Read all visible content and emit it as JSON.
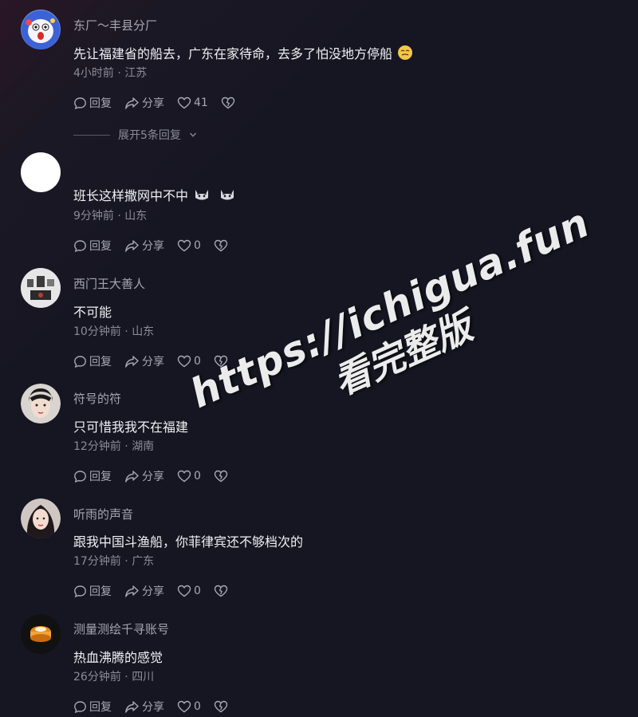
{
  "comments": [
    {
      "username": "东厂～丰县分厂",
      "text": "先让福建省的船去，广东在家待命，去多了怕没地方停船",
      "time": "4小时前",
      "location": "江苏",
      "reply_label": "回复",
      "share_label": "分享",
      "likes": "41",
      "emoji": "smug-face"
    },
    {
      "username": "",
      "text": "班长这样撒网中不中",
      "time": "9分钟前",
      "location": "山东",
      "reply_label": "回复",
      "share_label": "分享",
      "likes": "0",
      "emoji": "cat-face"
    },
    {
      "username": "西门王大善人",
      "text": "不可能",
      "time": "10分钟前",
      "location": "山东",
      "reply_label": "回复",
      "share_label": "分享",
      "likes": "0"
    },
    {
      "username": "符号的符",
      "text": "只可惜我我不在福建",
      "time": "12分钟前",
      "location": "湖南",
      "reply_label": "回复",
      "share_label": "分享",
      "likes": "0"
    },
    {
      "username": "听雨的声音",
      "text": "跟我中国斗渔船，你菲律宾还不够档次的",
      "time": "17分钟前",
      "location": "广东",
      "reply_label": "回复",
      "share_label": "分享",
      "likes": "0"
    },
    {
      "username": "测量测绘千寻账号",
      "text": "热血沸腾的感觉",
      "time": "26分钟前",
      "location": "四川",
      "reply_label": "回复",
      "share_label": "分享",
      "likes": "0"
    }
  ],
  "expand_replies": "展开5条回复",
  "meta_separator": "·",
  "watermark": {
    "url": "https://ichigua.fun",
    "subtitle": "看完整版"
  },
  "colors": {
    "background": "#161622",
    "text_primary": "#f0f0f4",
    "text_secondary": "#8c8c98"
  }
}
